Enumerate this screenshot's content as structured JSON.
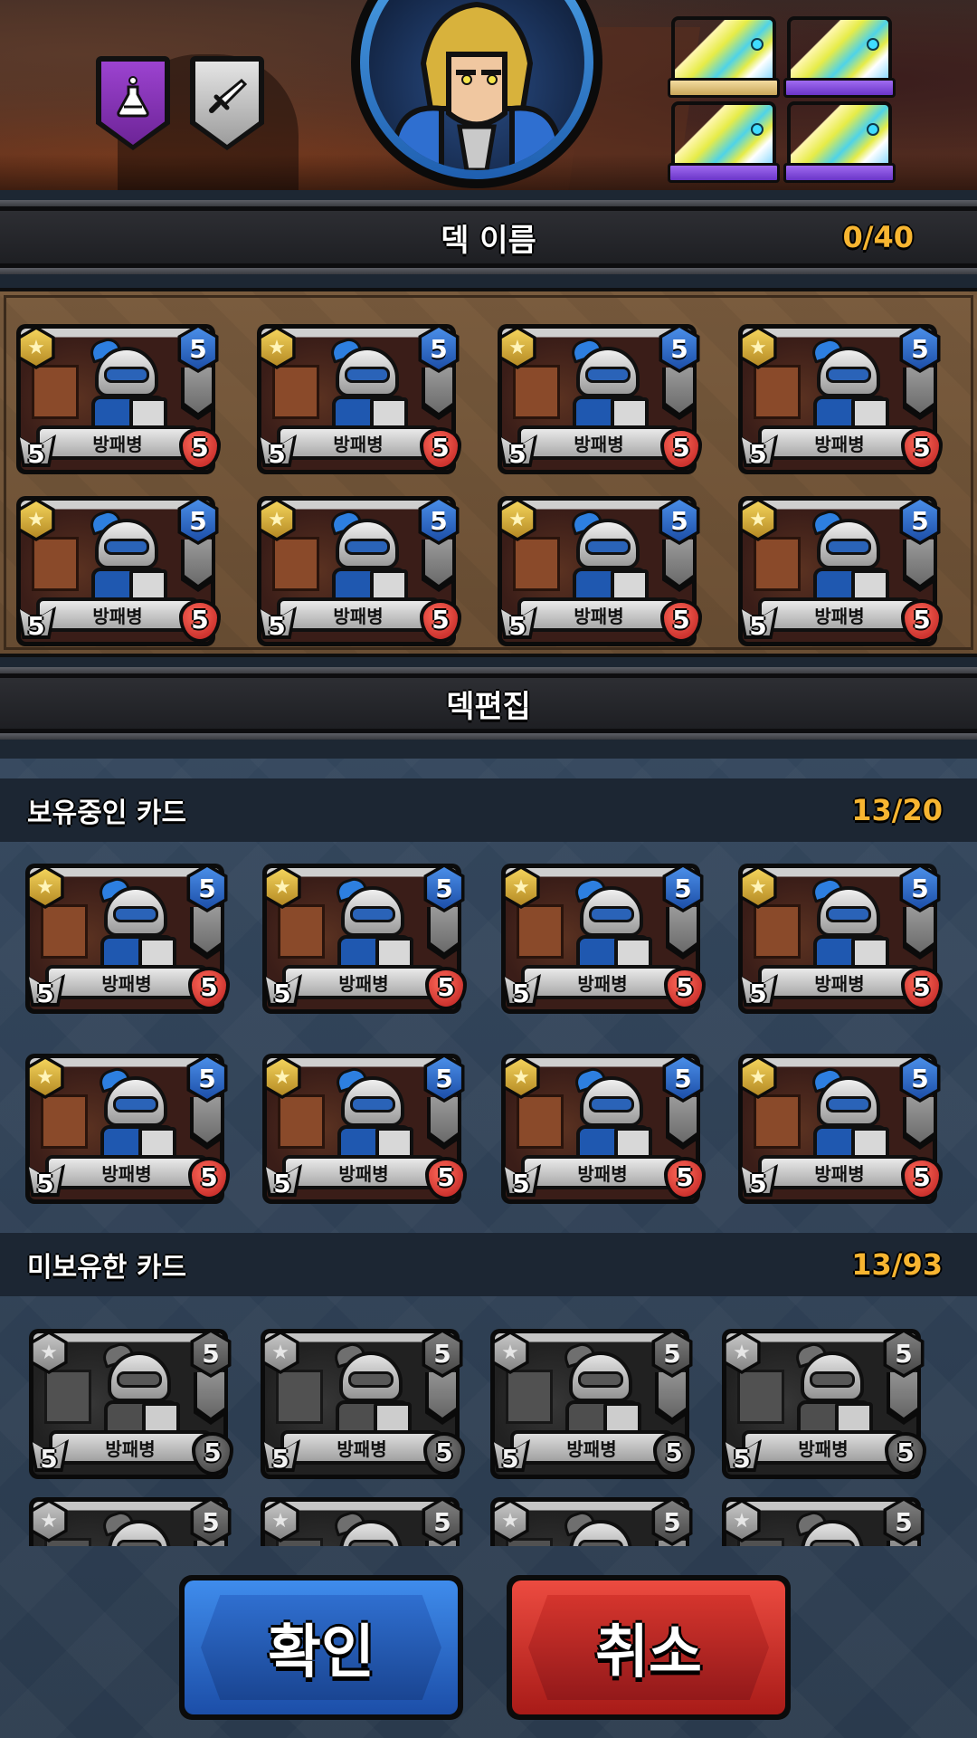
{
  "top": {
    "buttons": [
      {
        "name": "potion-filter-button",
        "icon": "flask-icon",
        "color": "#8a36c0"
      },
      {
        "name": "weapon-filter-button",
        "icon": "sword-icon",
        "color": "#c9c9c9"
      }
    ],
    "badges": [
      {
        "ribbon_color": "#d9b86a"
      },
      {
        "ribbon_color": "#7b4ae0"
      },
      {
        "ribbon_color": "#7b4ae0"
      },
      {
        "ribbon_color": "#7b4ae0"
      }
    ]
  },
  "deck": {
    "title": "덱 이름",
    "count": "0/40"
  },
  "edit_header": {
    "title": "덱편집"
  },
  "owned": {
    "label": "보유중인 카드",
    "count": "13/20"
  },
  "unowned": {
    "label": "미보유한 카드",
    "count": "13/93"
  },
  "card": {
    "name": "방패병",
    "cost": "5",
    "attack": "5",
    "health": "5"
  },
  "buttons": {
    "confirm": "확인",
    "cancel": "취소"
  },
  "colors": {
    "accent_count": "#f7b531",
    "confirm": "#2f6fd0",
    "cancel": "#d5352d"
  }
}
